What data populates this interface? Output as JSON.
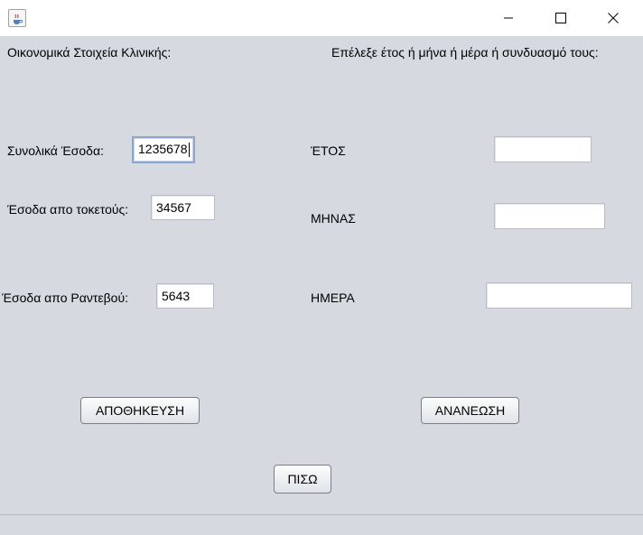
{
  "window": {
    "icon": "java-coffee-icon",
    "controls": [
      "minimize-icon",
      "maximize-icon",
      "close-icon"
    ]
  },
  "left_section": {
    "heading": "Οικονομικά Στοιχεία Κλινικής:",
    "total_income_label": "Συνολικά Έσοδα:",
    "total_income_value": "1235678",
    "births_income_label": "Έσοδα απο τοκετούς:",
    "births_income_value": "34567",
    "appointments_income_label": "Έσοδα απο Ραντεβού:",
    "appointments_income_value": "5643"
  },
  "right_section": {
    "heading": "Επέλεξε έτος ή μήνα ή μέρα ή συνδυασμό τους:",
    "year_label": "ΈΤΟΣ",
    "year_value": "",
    "month_label": "ΜΗΝΑΣ",
    "month_value": "",
    "day_label": "ΗΜΕΡΑ",
    "day_value": ""
  },
  "buttons": {
    "save": "ΑΠΟΘΗΚΕΥΣΗ",
    "refresh": "ΑΝΑΝΕΩΣΗ",
    "back": "ΠΙΣΩ"
  },
  "colors": {
    "panel_background": "#d6d9e0",
    "titlebar_background": "#ffffff",
    "focus_border": "#8fa6c8"
  }
}
